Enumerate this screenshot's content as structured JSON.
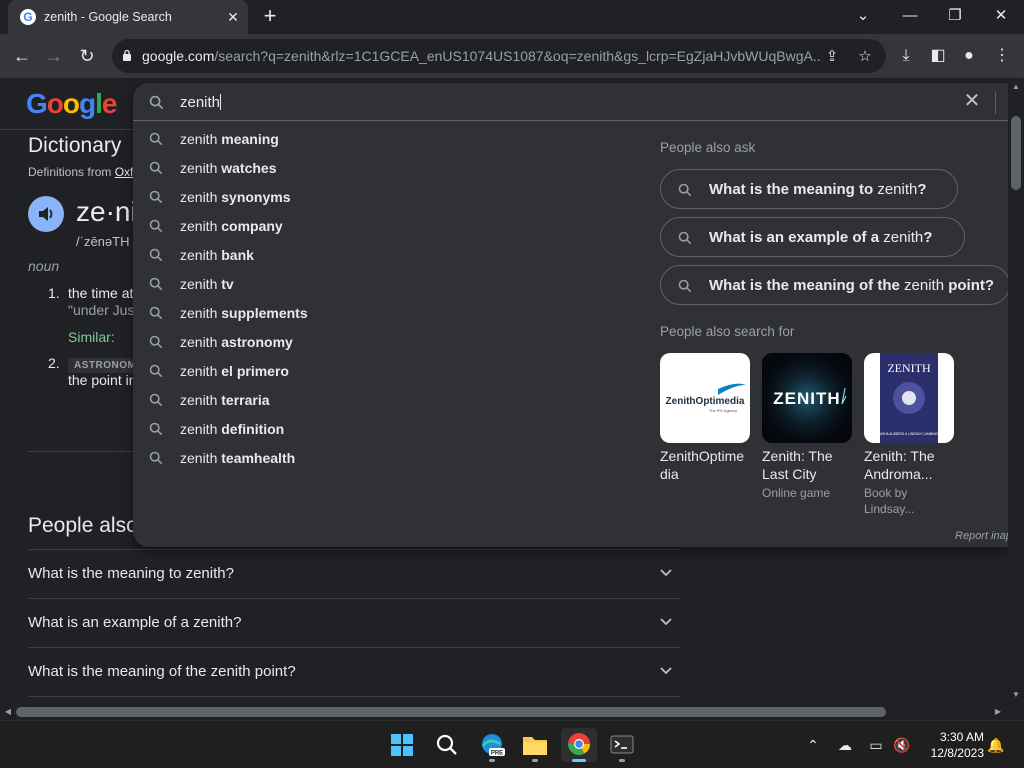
{
  "browser": {
    "tab_title": "zenith - Google Search",
    "tab_favicon": "G",
    "url_host": "google.com",
    "url_path": "/search?q=zenith&rlz=1C1GCEA_enUS1074US1087&oq=zenith&gs_lcrp=EgZjaHJvbWUqBwgA..."
  },
  "page": {
    "logo": "Google",
    "dictionary": {
      "title": "Dictionary",
      "source_prefix": "Definitions from ",
      "source_link": "Oxf",
      "word": "ze·ni",
      "phonetic": "/ˈzēnəTH",
      "pos": "noun",
      "def1_num": "1.",
      "def1_text": "the time at",
      "def1_example": "\"under Jus",
      "similar_label": "Similar:",
      "def2_num": "2.",
      "def2_tag": "ASTRONOM",
      "def2_text": "the point in"
    },
    "paa": {
      "title": "People also",
      "questions": [
        "What is the meaning to zenith?",
        "What is an example of a zenith?",
        "What is the meaning of the zenith point?"
      ]
    }
  },
  "search": {
    "query": "zenith",
    "suggestions": [
      {
        "prefix": "zenith ",
        "bold": "meaning"
      },
      {
        "prefix": "zenith ",
        "bold": "watches"
      },
      {
        "prefix": "zenith ",
        "bold": "synonyms"
      },
      {
        "prefix": "zenith ",
        "bold": "company"
      },
      {
        "prefix": "zenith ",
        "bold": "bank"
      },
      {
        "prefix": "zenith ",
        "bold": "tv"
      },
      {
        "prefix": "zenith ",
        "bold": "supplements"
      },
      {
        "prefix": "zenith ",
        "bold": "astronomy"
      },
      {
        "prefix": "zenith ",
        "bold": "el primero"
      },
      {
        "prefix": "zenith ",
        "bold": "terraria"
      },
      {
        "prefix": "zenith ",
        "bold": "definition"
      },
      {
        "prefix": "zenith ",
        "bold": "teamhealth"
      }
    ],
    "people_also_ask_label": "People also ask",
    "people_also_ask": [
      {
        "pre": "What is the meaning to ",
        "normal": "zenith",
        "post": "?"
      },
      {
        "pre": "What is an example of a ",
        "normal": "zenith",
        "post": "?"
      },
      {
        "pre": "What is the meaning of the ",
        "normal": "zenith",
        "post": " point?"
      }
    ],
    "people_also_search_label": "People also search for",
    "cards": [
      {
        "name": "ZenithOptimedia",
        "name_display": "ZenithOptime dia",
        "sub": "",
        "logo_text": "ZenithOptimedia",
        "logo_sub": "The RG Agency"
      },
      {
        "name": "Zenith: The Last City",
        "name_display": "Zenith: The Last City",
        "sub": "Online game",
        "logo_text": "ZENITH"
      },
      {
        "name": "Zenith: The Andromeda",
        "name_display": "Zenith: The Androma...",
        "sub": "Book by Lindsay...",
        "logo_text": "ZENITH",
        "logo_sub": "SASHA ALSBERG & LINDSAY CUMMINGS"
      }
    ],
    "report": "Report inap"
  },
  "taskbar": {
    "time": "3:30 AM",
    "date": "12/8/2023",
    "apps": [
      "start-icon",
      "search-icon",
      "edge-pre-icon",
      "file-explorer-icon",
      "chrome-icon",
      "terminal-icon"
    ]
  },
  "colors": {
    "bg": "#202124",
    "panel": "#303134",
    "accent_blue": "#8ab4f8",
    "similar_green": "#81c995"
  }
}
